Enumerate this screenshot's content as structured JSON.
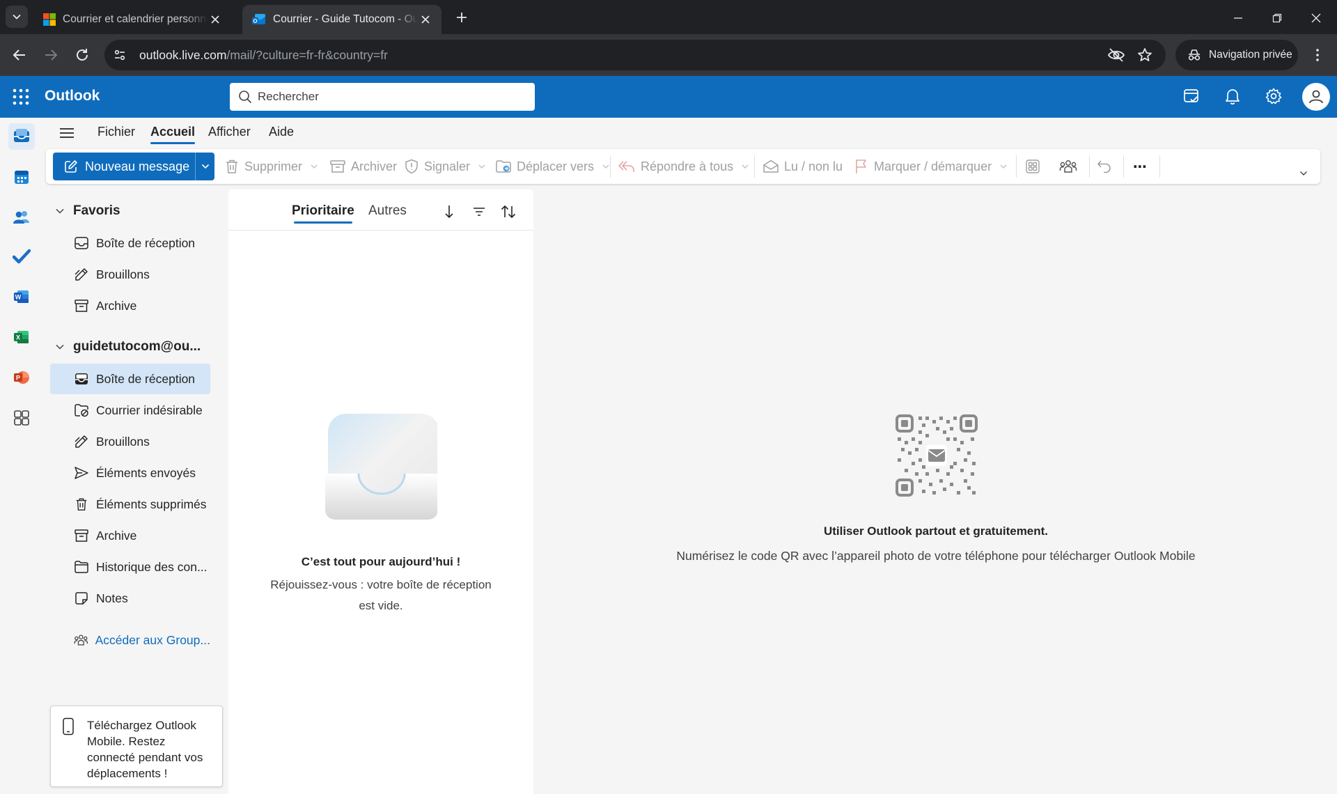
{
  "browser": {
    "tabs": [
      {
        "title": "Courrier et calendrier personnels",
        "favicon": "microsoft-logo",
        "active": false
      },
      {
        "title": "Courrier - Guide Tutocom - Outlook",
        "favicon": "outlook-logo",
        "active": true
      }
    ],
    "url": {
      "host": "outlook.live.com",
      "path": "/mail/?culture=fr-fr&country=fr"
    },
    "private_label": "Navigation privée"
  },
  "outlook": {
    "brand": "Outlook",
    "search_placeholder": "Rechercher",
    "menu": [
      "Fichier",
      "Accueil",
      "Afficher",
      "Aide"
    ],
    "menu_selected": "Accueil",
    "ribbon": {
      "new_message": "Nouveau message",
      "delete": "Supprimer",
      "archive": "Archiver",
      "report": "Signaler",
      "move_to": "Déplacer vers",
      "reply_all": "Répondre à tous",
      "read_unread": "Lu / non lu",
      "flag": "Marquer / démarquer",
      "more": "⋯"
    },
    "folders": {
      "favorites_title": "Favoris",
      "favorites": [
        {
          "label": "Boîte de réception",
          "icon": "inbox-icon"
        },
        {
          "label": "Brouillons",
          "icon": "drafts-icon"
        },
        {
          "label": "Archive",
          "icon": "archive-icon"
        }
      ],
      "account_title": "guidetutocom@ou...",
      "account": [
        {
          "label": "Boîte de réception",
          "icon": "inbox-icon",
          "selected": true
        },
        {
          "label": "Courrier indésirable",
          "icon": "junk-icon"
        },
        {
          "label": "Brouillons",
          "icon": "drafts-icon"
        },
        {
          "label": "Éléments envoyés",
          "icon": "sent-icon"
        },
        {
          "label": "Éléments supprimés",
          "icon": "trash-icon"
        },
        {
          "label": "Archive",
          "icon": "archive-icon"
        },
        {
          "label": "Historique des con...",
          "icon": "folder-icon"
        },
        {
          "label": "Notes",
          "icon": "notes-icon"
        }
      ],
      "groups_link": "Accéder aux Group...",
      "promo": "Téléchargez Outlook Mobile. Restez connecté pendant vos déplacements !"
    },
    "message_list": {
      "tabs": [
        "Prioritaire",
        "Autres"
      ],
      "selected_tab": "Prioritaire",
      "empty_title": "C’est tout pour aujourd’hui !",
      "empty_subtitle": "Réjouissez-vous : votre boîte de réception est vide."
    },
    "reading_pane": {
      "title": "Utiliser Outlook partout et gratuitement.",
      "subtitle": "Numérisez le code QR avec l’appareil photo de votre téléphone pour télécharger Outlook Mobile"
    },
    "colors": {
      "brand_blue": "#0f6cbd",
      "selected_folder": "#d4e5f7"
    }
  }
}
